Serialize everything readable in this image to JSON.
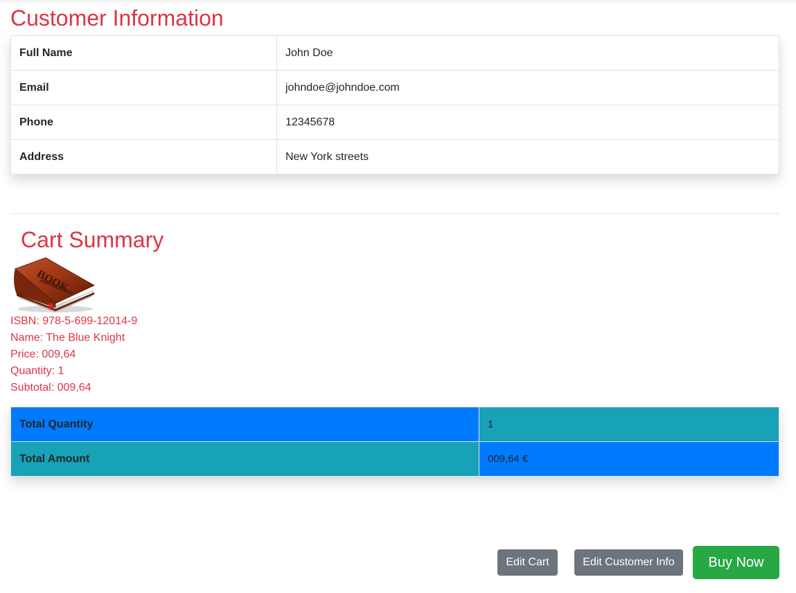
{
  "customer": {
    "title": "Customer Information",
    "rows": [
      {
        "label": "Full Name",
        "value": "John Doe"
      },
      {
        "label": "Email",
        "value": "johndoe@johndoe.com"
      },
      {
        "label": "Phone",
        "value": "12345678"
      },
      {
        "label": "Address",
        "value": "New York streets"
      }
    ]
  },
  "cart": {
    "title": "Cart Summary",
    "item": {
      "image_icon": "book-icon",
      "image_text": "BOOK",
      "isbn": "ISBN: 978-5-699-12014-9",
      "name": "Name: The Blue Knight",
      "price": "Price: 009,64",
      "quantity": "Quantity: 1",
      "subtotal": "Subtotal: 009,64"
    },
    "totals": [
      {
        "label": "Total Quantity",
        "value": "1"
      },
      {
        "label": "Total Amount",
        "value": "009,64 €"
      }
    ]
  },
  "actions": {
    "edit_cart": "Edit Cart",
    "edit_customer": "Edit Customer Info",
    "buy_now": "Buy Now"
  },
  "colors": {
    "title": "#dc3545",
    "primary": "#007bff",
    "info": "#17a2b8",
    "secondary": "#6c757d",
    "success": "#28a745"
  }
}
